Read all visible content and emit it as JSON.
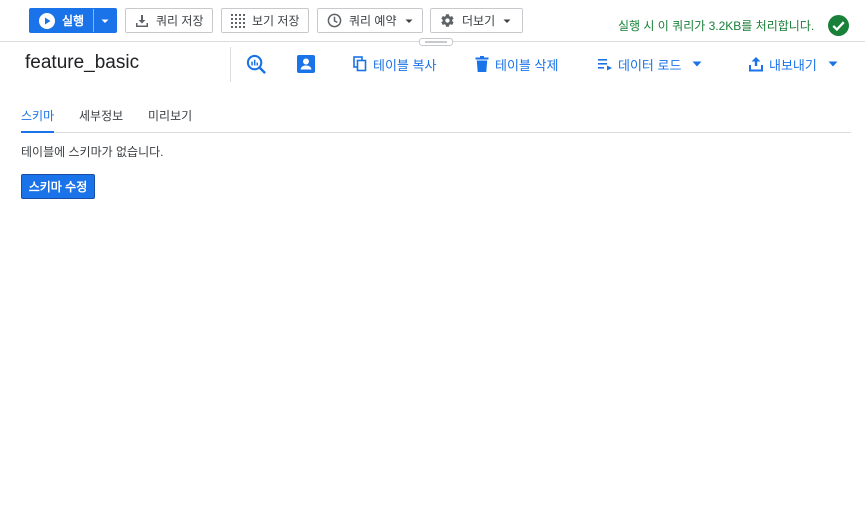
{
  "toolbar": {
    "run_label": "실행",
    "save_query_label": "쿼리 저장",
    "save_view_label": "보기 저장",
    "schedule_label": "쿼리 예약",
    "more_label": "더보기",
    "status_message": "실행 시 이 쿼리가 3.2KB를 처리합니다.",
    "status_color": "#188038"
  },
  "table": {
    "name": "feature_basic",
    "actions": {
      "copy_label": "테이블 복사",
      "delete_label": "테이블 삭제",
      "load_label": "데이터 로드",
      "export_label": "내보내기"
    }
  },
  "tabs": [
    {
      "label": "스키마",
      "active": true
    },
    {
      "label": "세부정보",
      "active": false
    },
    {
      "label": "미리보기",
      "active": false
    }
  ],
  "schema": {
    "empty_message": "테이블에 스키마가 없습니다.",
    "edit_button_label": "스키마 수정"
  },
  "colors": {
    "accent": "#1a73e8",
    "success": "#188038",
    "border": "#dadce0"
  },
  "icons": [
    "play-circle-icon",
    "download-icon",
    "grid-icon",
    "clock-icon",
    "gear-icon",
    "check-circle-icon",
    "query-search-icon",
    "profile-icon",
    "copy-icon",
    "trash-icon",
    "load-list-icon",
    "upload-icon",
    "caret-down-icon"
  ]
}
